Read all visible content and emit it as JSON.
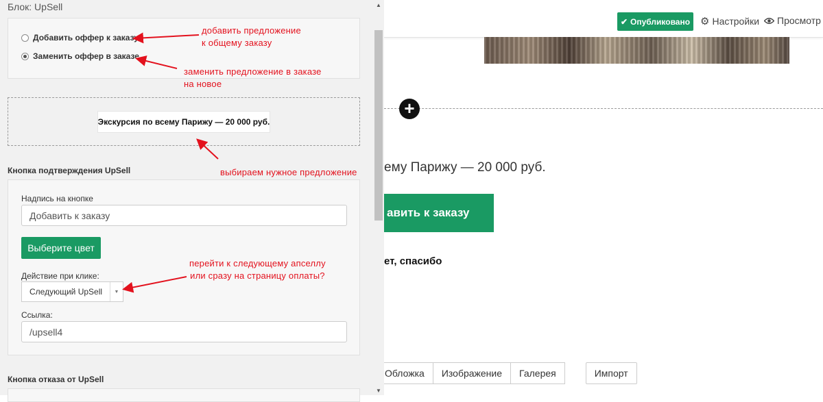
{
  "panel": {
    "title": "Блок: UpSell",
    "mode_options": [
      {
        "label": "Добавить оффер к заказу",
        "checked": false
      },
      {
        "label": "Заменить оффер в заказе",
        "checked": true
      }
    ],
    "selected_offer": "Экскурсия по всему Парижу — 20 000 руб.",
    "confirm_section": {
      "title": "Кнопка подтверждения UpSell",
      "button_text_label": "Надпись на кнопке",
      "button_text_value": "Добавить к заказу",
      "color_button_label": "Выберите цвет",
      "action_label": "Действие при клике:",
      "action_value": "Следующий UpSell",
      "link_label": "Ссылка:",
      "link_value": "/upsell4"
    },
    "reject_section": {
      "title": "Кнопка отказа от UpSell"
    }
  },
  "annotations": {
    "add_offer": [
      "добавить предложение",
      "к общему заказу"
    ],
    "replace_offer": [
      "заменить предложение в заказе",
      "на новое"
    ],
    "choose_offer": "выбираем нужное предложение",
    "next_action": [
      "перейти к следующему апселлу",
      "или сразу на страницу оплаты?"
    ]
  },
  "topbar": {
    "published_label": "Опубликовано",
    "settings_label": "Настройки",
    "preview_label": "Просмотр"
  },
  "canvas": {
    "offer_text_partial": "ему Парижу — 20 000 руб.",
    "cta_partial": "авить к заказу",
    "thanks_partial": "ет, спасибо",
    "bottom_tabs": [
      "Обложка",
      "Изображение",
      "Галерея"
    ],
    "import_label": "Импорт"
  },
  "colors": {
    "accent_green": "#1a9a63",
    "annotation_red": "#e3111d"
  }
}
